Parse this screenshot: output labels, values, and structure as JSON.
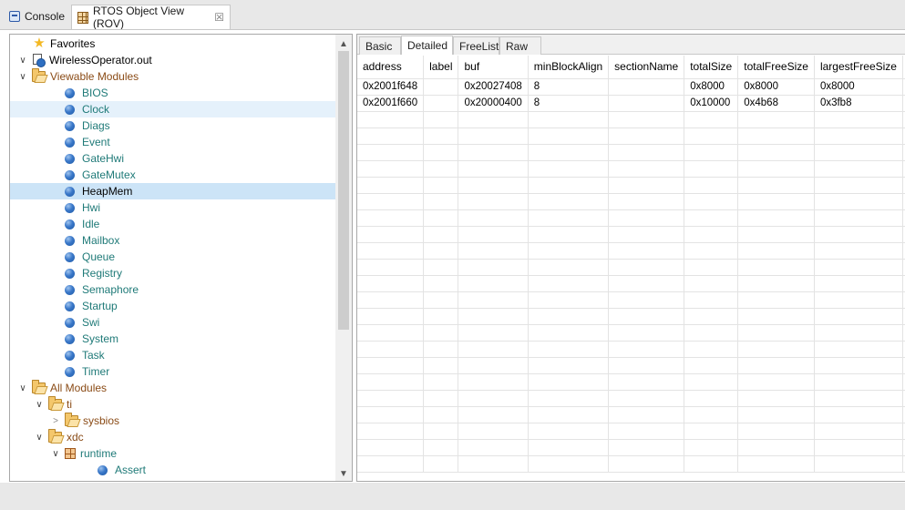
{
  "view_tabs": {
    "console_label": "Console",
    "rov_label": "RTOS Object View (ROV)",
    "close_glyph": "☒"
  },
  "tree": {
    "items": [
      {
        "label": "Favorites",
        "icon": "star-icon",
        "color": "black",
        "twist": "none",
        "indent": 0,
        "state": ""
      },
      {
        "label": "WirelessOperator.out",
        "icon": "app-icon",
        "color": "black",
        "twist": "expanded",
        "indent": 0,
        "state": ""
      },
      {
        "label": "Viewable Modules",
        "icon": "folder-icon",
        "color": "brown",
        "twist": "expanded",
        "indent": 1,
        "state": ""
      },
      {
        "label": "BIOS",
        "icon": "module-icon",
        "color": "teal",
        "twist": "none",
        "indent": 3,
        "state": ""
      },
      {
        "label": "Clock",
        "icon": "module-icon",
        "color": "teal",
        "twist": "none",
        "indent": 3,
        "state": "hover"
      },
      {
        "label": "Diags",
        "icon": "module-icon",
        "color": "teal",
        "twist": "none",
        "indent": 3,
        "state": ""
      },
      {
        "label": "Event",
        "icon": "module-icon",
        "color": "teal",
        "twist": "none",
        "indent": 3,
        "state": ""
      },
      {
        "label": "GateHwi",
        "icon": "module-icon",
        "color": "teal",
        "twist": "none",
        "indent": 3,
        "state": ""
      },
      {
        "label": "GateMutex",
        "icon": "module-icon",
        "color": "teal",
        "twist": "none",
        "indent": 3,
        "state": ""
      },
      {
        "label": "HeapMem",
        "icon": "module-icon",
        "color": "black",
        "twist": "none",
        "indent": 3,
        "state": "selected"
      },
      {
        "label": "Hwi",
        "icon": "module-icon",
        "color": "teal",
        "twist": "none",
        "indent": 3,
        "state": ""
      },
      {
        "label": "Idle",
        "icon": "module-icon",
        "color": "teal",
        "twist": "none",
        "indent": 3,
        "state": ""
      },
      {
        "label": "Mailbox",
        "icon": "module-icon",
        "color": "teal",
        "twist": "none",
        "indent": 3,
        "state": ""
      },
      {
        "label": "Queue",
        "icon": "module-icon",
        "color": "teal",
        "twist": "none",
        "indent": 3,
        "state": ""
      },
      {
        "label": "Registry",
        "icon": "module-icon",
        "color": "teal",
        "twist": "none",
        "indent": 3,
        "state": ""
      },
      {
        "label": "Semaphore",
        "icon": "module-icon",
        "color": "teal",
        "twist": "none",
        "indent": 3,
        "state": ""
      },
      {
        "label": "Startup",
        "icon": "module-icon",
        "color": "teal",
        "twist": "none",
        "indent": 3,
        "state": ""
      },
      {
        "label": "Swi",
        "icon": "module-icon",
        "color": "teal",
        "twist": "none",
        "indent": 3,
        "state": ""
      },
      {
        "label": "System",
        "icon": "module-icon",
        "color": "teal",
        "twist": "none",
        "indent": 3,
        "state": ""
      },
      {
        "label": "Task",
        "icon": "module-icon",
        "color": "teal",
        "twist": "none",
        "indent": 3,
        "state": ""
      },
      {
        "label": "Timer",
        "icon": "module-icon",
        "color": "teal",
        "twist": "none",
        "indent": 3,
        "state": ""
      },
      {
        "label": "All Modules",
        "icon": "folder-icon",
        "color": "brown",
        "twist": "expanded",
        "indent": 1,
        "state": ""
      },
      {
        "label": "ti",
        "icon": "folder-icon",
        "color": "brown",
        "twist": "expanded",
        "indent": 2,
        "state": ""
      },
      {
        "label": "sysbios",
        "icon": "folder-icon",
        "color": "brown",
        "twist": "collapsed",
        "indent": 3,
        "state": ""
      },
      {
        "label": "xdc",
        "icon": "folder-icon",
        "color": "brown",
        "twist": "expanded",
        "indent": 2,
        "state": ""
      },
      {
        "label": "runtime",
        "icon": "package-icon",
        "color": "teal",
        "twist": "expanded",
        "indent": 3,
        "state": ""
      },
      {
        "label": "Assert",
        "icon": "module-icon",
        "color": "teal",
        "twist": "none",
        "indent": 5,
        "state": ""
      }
    ]
  },
  "detail": {
    "tabs": [
      "Basic",
      "Detailed",
      "FreeList",
      "Raw"
    ],
    "active_tab": "Detailed",
    "columns": [
      "address",
      "label",
      "buf",
      "minBlockAlign",
      "sectionName",
      "totalSize",
      "totalFreeSize",
      "largestFreeSize"
    ],
    "rows": [
      [
        "0x2001f648",
        "",
        "0x20027408",
        "8",
        "",
        "0x8000",
        "0x8000",
        "0x8000"
      ],
      [
        "0x2001f660",
        "",
        "0x20000400",
        "8",
        "",
        "0x10000",
        "0x4b68",
        "0x3fb8"
      ]
    ]
  },
  "colors": {
    "module_label": "#1f7a78",
    "folder_label": "#8a4b16",
    "selected_row": "#cce4f7",
    "hover_row": "#e5f1fb"
  }
}
